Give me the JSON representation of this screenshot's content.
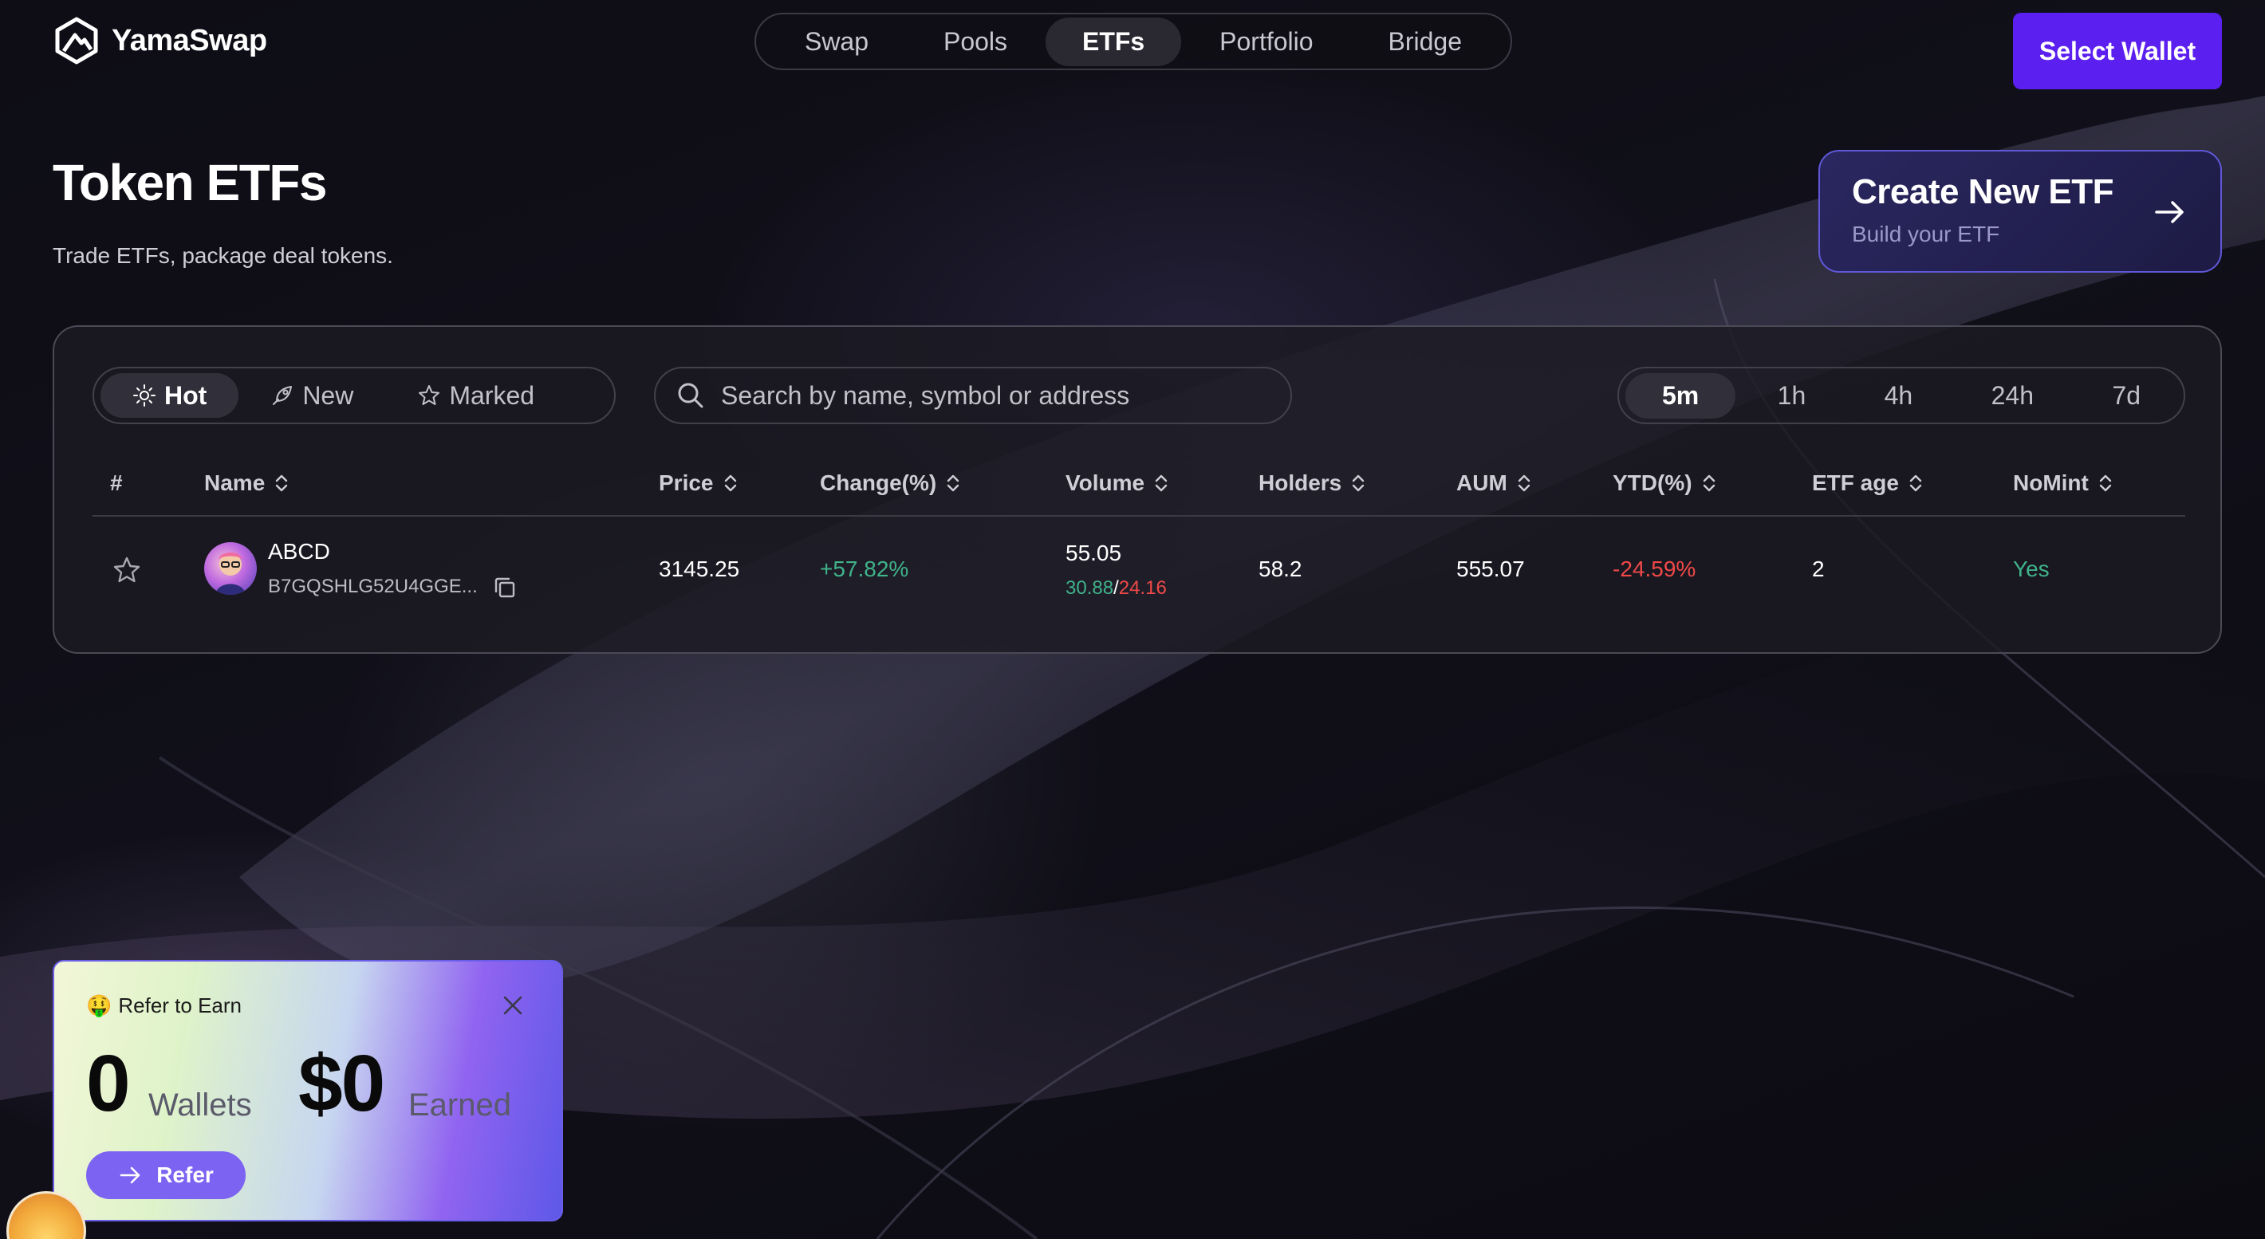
{
  "brand": {
    "name": "YamaSwap"
  },
  "nav": {
    "items": [
      "Swap",
      "Pools",
      "ETFs",
      "Portfolio",
      "Bridge"
    ],
    "active": "ETFs"
  },
  "header": {
    "wallet_button": "Select Wallet"
  },
  "page": {
    "title": "Token ETFs",
    "subtitle": "Trade ETFs, package deal tokens."
  },
  "create_card": {
    "title": "Create New ETF",
    "subtitle": "Build your ETF"
  },
  "filters": {
    "items": [
      "Hot",
      "New",
      "Marked"
    ],
    "active": "Hot",
    "icons": [
      "sun-icon",
      "rocket-icon",
      "star-icon"
    ]
  },
  "search": {
    "placeholder": "Search by name, symbol or address",
    "value": ""
  },
  "timeframes": {
    "items": [
      "5m",
      "1h",
      "4h",
      "24h",
      "7d"
    ],
    "active": "5m"
  },
  "table": {
    "columns": [
      "#",
      "Name",
      "Price",
      "Change(%)",
      "Volume",
      "Holders",
      "AUM",
      "YTD(%)",
      "ETF age",
      "NoMint"
    ],
    "rows": [
      {
        "name": "ABCD",
        "address": "B7GQSHLG52U4GGE...",
        "price": "3145.25",
        "change": "+57.82%",
        "volume": "55.05",
        "volume_buy": "30.88",
        "volume_sep": "/",
        "volume_sell": "24.16",
        "holders": "58.2",
        "aum": "555.07",
        "ytd": "-24.59%",
        "etf_age": "2",
        "nomint": "Yes"
      }
    ]
  },
  "refer": {
    "emoji": "🤑",
    "title": "Refer to Earn",
    "wallets_value": "0",
    "wallets_label": "Wallets",
    "earned_value": "$0",
    "earned_label": "Earned",
    "button": "Refer"
  },
  "colors": {
    "accent": "#5b1ff0",
    "positive": "#3fb38a",
    "negative": "#f04848",
    "create_border": "#6058d8"
  }
}
